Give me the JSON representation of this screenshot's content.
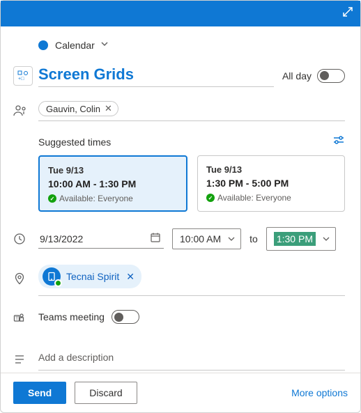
{
  "calendar": {
    "label": "Calendar"
  },
  "event": {
    "title": "Screen Grids"
  },
  "allday": {
    "label": "All day"
  },
  "attendees": [
    {
      "name": "Gauvin, Colin"
    }
  ],
  "suggested": {
    "label": "Suggested times",
    "cards": [
      {
        "date": "Tue 9/13",
        "time": "10:00 AM - 1:30 PM",
        "avail": "Available: Everyone"
      },
      {
        "date": "Tue 9/13",
        "time": "1:30 PM - 5:00 PM",
        "avail": "Available: Everyone"
      }
    ]
  },
  "datetime": {
    "date": "9/13/2022",
    "start": "10:00 AM",
    "to": "to",
    "end": "1:30 PM"
  },
  "location": {
    "name": "Tecnai Spirit"
  },
  "teams": {
    "label": "Teams meeting"
  },
  "description": {
    "placeholder": "Add a description"
  },
  "footer": {
    "send": "Send",
    "discard": "Discard",
    "more": "More options"
  }
}
